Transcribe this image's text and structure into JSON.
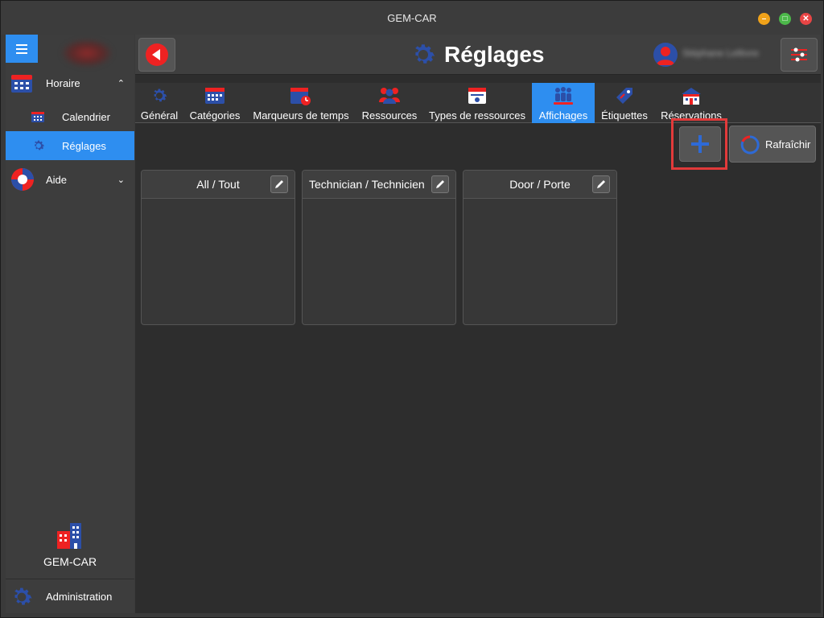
{
  "window": {
    "title": "GEM-CAR"
  },
  "sidebar": {
    "groups": [
      {
        "label": "Horaire",
        "chevron": "⌃"
      },
      {
        "label": "Aide",
        "chevron": "⌄"
      }
    ],
    "items": [
      {
        "label": "Calendrier"
      },
      {
        "label": "Réglages"
      }
    ],
    "brand_label": "GEM-CAR",
    "admin_label": "Administration"
  },
  "header": {
    "title": "Réglages",
    "user_name": "Stéphane Lefèvre"
  },
  "tabs": [
    {
      "label": "Général",
      "icon": "gear-icon"
    },
    {
      "label": "Catégories",
      "icon": "calendar-grid-icon"
    },
    {
      "label": "Marqueurs de temps",
      "icon": "calendar-clock-icon"
    },
    {
      "label": "Ressources",
      "icon": "people-icon"
    },
    {
      "label": "Types de ressources",
      "icon": "id-card-icon"
    },
    {
      "label": "Affichages",
      "icon": "group-icon"
    },
    {
      "label": "Étiquettes",
      "icon": "tag-icon"
    },
    {
      "label": "Réservations",
      "icon": "building-icon"
    }
  ],
  "active_tab": "Affichages",
  "toolbar": {
    "refresh_label": "Rafraîchir"
  },
  "cards": [
    {
      "title": "All / Tout"
    },
    {
      "title": "Technician / Technicien"
    },
    {
      "title": "Door / Porte"
    }
  ],
  "colors": {
    "accent": "#2e8ef0",
    "brand_red": "#e22222",
    "brand_blue": "#2c4fa8",
    "highlight": "#e23a3a"
  }
}
